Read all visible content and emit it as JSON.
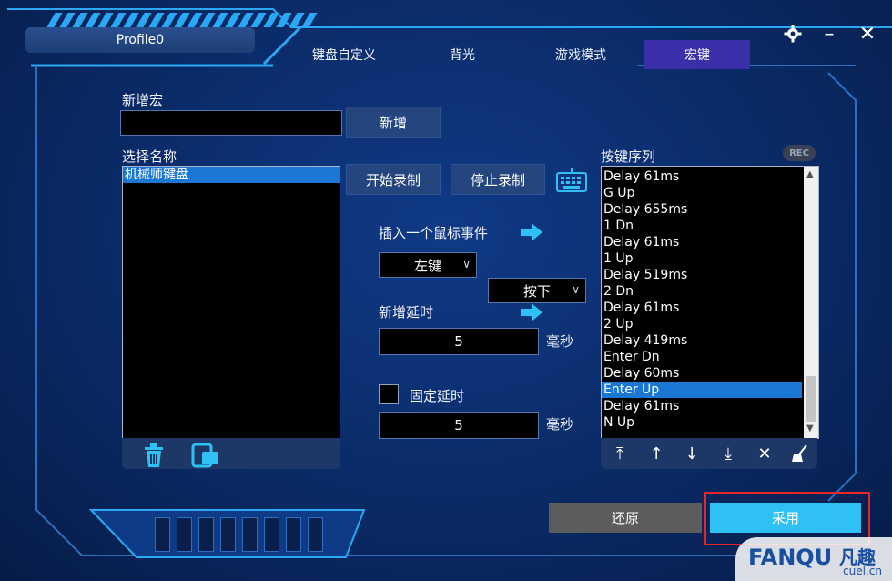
{
  "profile": {
    "name": "Profile0"
  },
  "tabs": [
    {
      "label": "键盘自定义"
    },
    {
      "label": "背光"
    },
    {
      "label": "游戏模式"
    },
    {
      "label": "宏键"
    }
  ],
  "window": {
    "settings_icon": "gear-icon",
    "minimize": "–",
    "close": "✕"
  },
  "macro": {
    "new_macro_label": "新增宏",
    "new_macro_value": "",
    "add_button": "新增",
    "select_name_label": "选择名称",
    "names": [
      "机械师键盘"
    ],
    "selected_name": "机械师键盘",
    "start_record": "开始录制",
    "stop_record": "停止录制",
    "insert_mouse_label": "插入一个鼠标事件",
    "mouse_button": "左键",
    "mouse_action": "按下",
    "add_delay_label": "新增延时",
    "add_delay_value": "5",
    "unit": "毫秒",
    "fixed_delay_label": "固定延时",
    "fixed_delay_checked": false,
    "fixed_delay_value": "5",
    "unit2": "毫秒"
  },
  "sequence": {
    "label": "按键序列",
    "rec": "REC",
    "items": [
      "Delay 61ms",
      "G Up",
      "Delay 655ms",
      "1 Dn",
      "Delay 61ms",
      "1 Up",
      "Delay 519ms",
      "2 Dn",
      "Delay 61ms",
      "2 Up",
      "Delay 419ms",
      "Enter Dn",
      "Delay 60ms",
      "Enter Up",
      "Delay 61ms",
      "N Up"
    ],
    "selected_index": 13
  },
  "footer": {
    "restore": "还原",
    "apply": "采用"
  },
  "watermark": {
    "brand": "FANQU",
    "cn": "凡趣",
    "site": "cuel.cn"
  },
  "colors": {
    "accent": "#2fc0f4",
    "active_tab": "#3a2fa8",
    "selection": "#1a78d4",
    "highlight_box": "#e8262a"
  }
}
